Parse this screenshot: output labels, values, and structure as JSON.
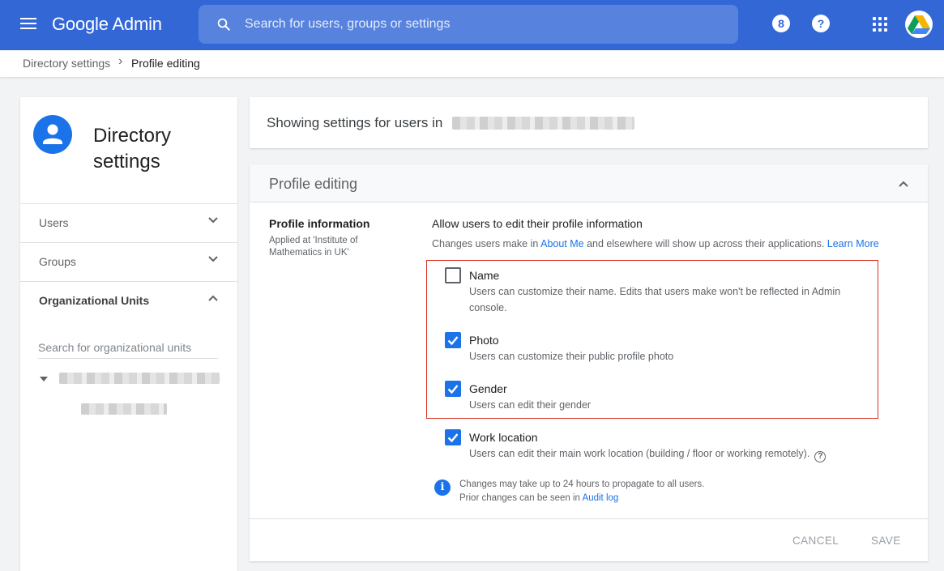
{
  "header": {
    "app_title": "Google Admin",
    "search_placeholder": "Search for users, groups or settings",
    "support_icon_glyph": "8",
    "help_icon_glyph": "?"
  },
  "breadcrumb": {
    "parent": "Directory settings",
    "separator": "›",
    "current": "Profile editing"
  },
  "sidebar": {
    "title_line1": "Directory",
    "title_line2": "settings",
    "items": [
      {
        "label": "Users",
        "expanded": false
      },
      {
        "label": "Groups",
        "expanded": false
      },
      {
        "label": "Organizational Units",
        "expanded": true
      }
    ],
    "ou_search_placeholder": "Search for organizational units"
  },
  "scope": {
    "text": "Showing settings for users in"
  },
  "section": {
    "header_title": "Profile editing",
    "title": "Profile information",
    "applied_at": "Applied at 'Institute of Mathematics in UK'",
    "allow_title": "Allow users to edit their profile information",
    "allow_desc_prefix": "Changes users make in ",
    "about_me_link": "About Me",
    "allow_desc_middle": " and elsewhere will show up across their applications. ",
    "learn_more_link": "Learn More",
    "options": [
      {
        "title": "Name",
        "description": "Users can customize their name. Edits that users make won't be reflected in Admin console.",
        "checked": false
      },
      {
        "title": "Photo",
        "description": "Users can customize their public profile photo",
        "checked": true
      },
      {
        "title": "Gender",
        "description": "Users can edit their gender",
        "checked": true
      },
      {
        "title": "Work location",
        "description": "Users can edit their main work location (building / floor or working remotely).",
        "checked": true
      }
    ],
    "info_icon_glyph": "i",
    "note_line1": "Changes may take up to 24 hours to propagate to all users.",
    "note_line2_prefix": "Prior changes can be seen in ",
    "audit_log_link": "Audit log",
    "cancel_label": "CANCEL",
    "save_label": "SAVE"
  },
  "colors": {
    "topbar": "#3367d6",
    "accent": "#1a73e8",
    "highlight_border": "#d93025"
  }
}
